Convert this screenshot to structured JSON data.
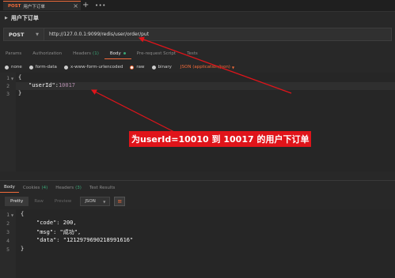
{
  "tabs": [
    {
      "method": "POST",
      "name": "用户下订单"
    }
  ],
  "tab_add_glyph": "+",
  "tab_more_glyph": "•••",
  "request": {
    "name": "用户下订单",
    "method": "POST",
    "url": "http://127.0.0.1:9099/redis/user/order/put"
  },
  "request_tabs": [
    {
      "label": "Params",
      "count": ""
    },
    {
      "label": "Authorization",
      "count": ""
    },
    {
      "label": "Headers",
      "count": "(1)"
    },
    {
      "label": "Body",
      "count": "",
      "active": true
    },
    {
      "label": "Pre-request Script",
      "count": ""
    },
    {
      "label": "Tests",
      "count": ""
    }
  ],
  "body_types": [
    {
      "label": "none"
    },
    {
      "label": "form-data"
    },
    {
      "label": "x-www-form-urlencoded"
    },
    {
      "label": "raw",
      "selected": true
    },
    {
      "label": "binary"
    }
  ],
  "content_type": "JSON (application/json)",
  "request_body_lines": [
    {
      "num": "1",
      "text": "{"
    },
    {
      "num": "2",
      "key": "\"userId\"",
      "sep": ":",
      "value": "10017"
    },
    {
      "num": "3",
      "text": "}"
    }
  ],
  "annotation": "为userId=10010 到 10017 的用户下订单",
  "response_tabs": [
    {
      "label": "Body",
      "count": "",
      "active": true
    },
    {
      "label": "Cookies",
      "count": "(4)"
    },
    {
      "label": "Headers",
      "count": "(3)"
    },
    {
      "label": "Test Results",
      "count": ""
    }
  ],
  "view_modes": [
    {
      "label": "Pretty",
      "active": true
    },
    {
      "label": "Raw"
    },
    {
      "label": "Preview"
    }
  ],
  "response_format": "JSON",
  "response_body_lines": [
    {
      "num": "1",
      "text": "{"
    },
    {
      "num": "2",
      "key": "\"code\"",
      "value": "200"
    },
    {
      "num": "3",
      "key": "\"msg\"",
      "value": "\"成功\""
    },
    {
      "num": "4",
      "key": "\"data\"",
      "value": "\"1212979690218991616\""
    },
    {
      "num": "5",
      "text": "}"
    }
  ],
  "colors": {
    "accent": "#f26b3a",
    "annotation_bg": "#e0141a",
    "count_green": "#3aa676",
    "number_purple": "#b48ead"
  }
}
